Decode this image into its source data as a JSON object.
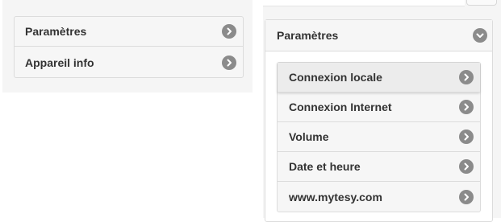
{
  "left_panel": {
    "items": [
      {
        "label": "Paramètres",
        "icon": "chevron-right-icon"
      },
      {
        "label": "Appareil info",
        "icon": "chevron-right-icon"
      }
    ]
  },
  "right_panel": {
    "header": {
      "label": "Paramètres",
      "icon": "chevron-down-icon"
    },
    "items": [
      {
        "label": "Connexion locale",
        "icon": "chevron-right-icon",
        "active": true
      },
      {
        "label": "Connexion Internet",
        "icon": "chevron-right-icon"
      },
      {
        "label": "Volume",
        "icon": "chevron-right-icon"
      },
      {
        "label": "Date et heure",
        "icon": "chevron-right-icon"
      },
      {
        "label": "www.mytesy.com",
        "icon": "chevron-right-icon"
      }
    ]
  },
  "colors": {
    "panel_bg": "#f5f5f5",
    "card_bg": "#f6f6f6",
    "border": "#dcdcdc",
    "text": "#333333",
    "icon_bg": "#8b8b8b"
  }
}
